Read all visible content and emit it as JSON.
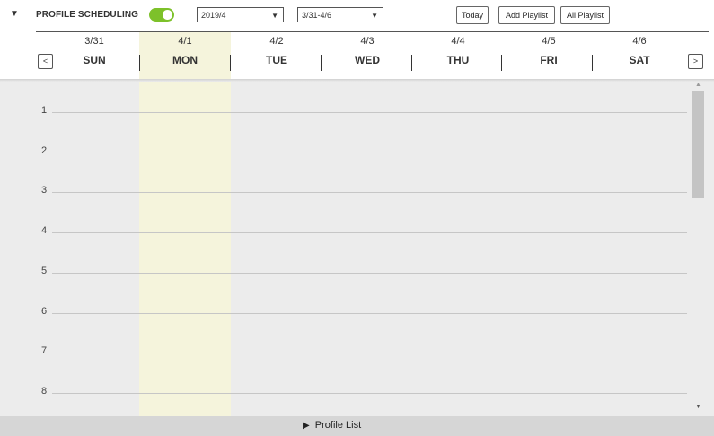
{
  "header": {
    "collapse_icon": "▼",
    "title": "PROFILE SCHEDULING",
    "toggle_on": true,
    "toggle_color": "#7dc12a",
    "month_value": "2019/4",
    "week_value": "3/31-4/6",
    "select_caret": "▼",
    "today_label": "Today",
    "add_playlist_label": "Add Playlist",
    "all_playlist_label": "All Playlist",
    "prev_label": "<",
    "next_label": ">"
  },
  "days": [
    {
      "date": "3/31",
      "dow": "SUN"
    },
    {
      "date": "4/1",
      "dow": "MON"
    },
    {
      "date": "4/2",
      "dow": "TUE"
    },
    {
      "date": "4/3",
      "dow": "WED"
    },
    {
      "date": "4/4",
      "dow": "THU"
    },
    {
      "date": "4/5",
      "dow": "FRI"
    },
    {
      "date": "4/6",
      "dow": "SAT"
    }
  ],
  "today_highlight_color": "#f5f4dc",
  "hours": [
    "1",
    "2",
    "3",
    "4",
    "5",
    "6",
    "7",
    "8"
  ],
  "scroll": {
    "up": "▲",
    "down": "▼"
  },
  "footer": {
    "arrow": "▶",
    "label": "Profile List"
  }
}
